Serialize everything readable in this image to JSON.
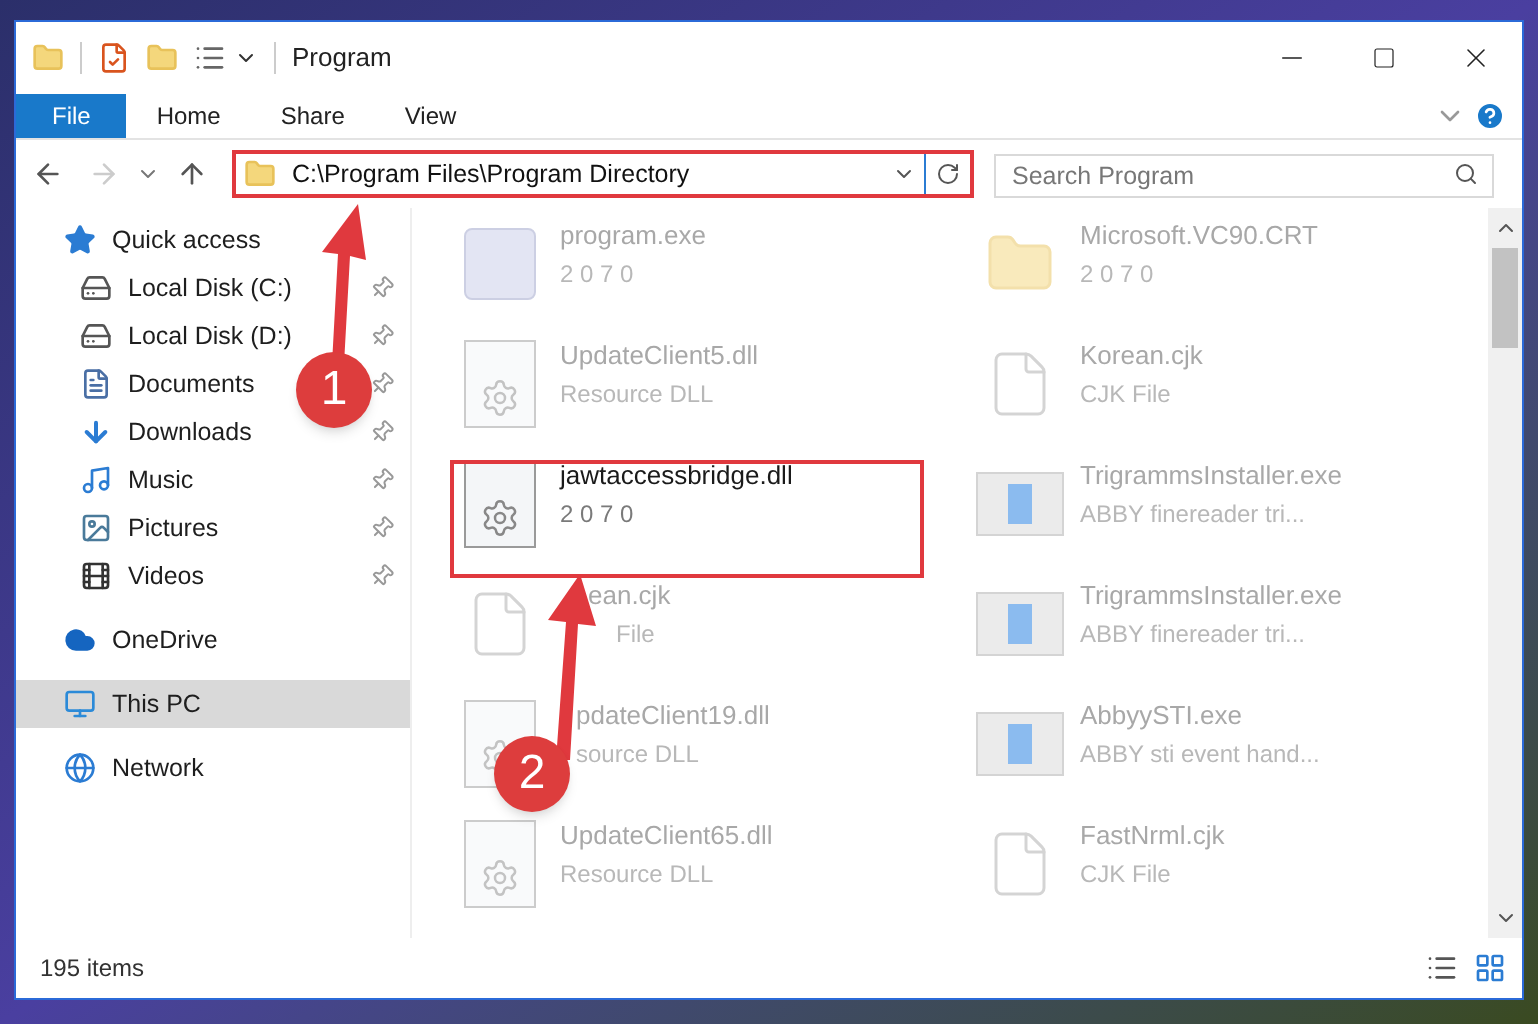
{
  "window": {
    "title": "Program"
  },
  "ribbon_tabs": [
    {
      "label": "File",
      "selected": true
    },
    {
      "label": "Home",
      "selected": false
    },
    {
      "label": "Share",
      "selected": false
    },
    {
      "label": "View",
      "selected": false
    }
  ],
  "address_bar": {
    "path": "C:\\Program Files\\Program Directory"
  },
  "search": {
    "placeholder": "Search Program"
  },
  "sidebar": {
    "items": [
      {
        "label": "Quick access",
        "kind": "star",
        "selected": false,
        "children": [
          {
            "label": "Local Disk (C:)",
            "kind": "system-drive",
            "pinned": true,
            "selected": false
          },
          {
            "label": "Local Disk (D:)",
            "kind": "drive",
            "pinned": true,
            "selected": false
          },
          {
            "label": "Documents",
            "kind": "documents",
            "pinned": true,
            "selected": false
          },
          {
            "label": "Downloads",
            "kind": "downloads",
            "pinned": true,
            "selected": false
          },
          {
            "label": "Music",
            "kind": "music",
            "pinned": true,
            "selected": false
          },
          {
            "label": "Pictures",
            "kind": "pictures",
            "pinned": true,
            "selected": false
          },
          {
            "label": "Videos",
            "kind": "videos",
            "pinned": true,
            "selected": false
          }
        ]
      },
      {
        "label": "OneDrive",
        "kind": "cloud",
        "selected": false
      },
      {
        "label": "This PC",
        "kind": "pc",
        "selected": true
      },
      {
        "label": "Network",
        "kind": "network",
        "selected": false
      }
    ]
  },
  "files": [
    {
      "name": "program.exe",
      "detail": "2 0 7 0",
      "kind": "app",
      "faded": true
    },
    {
      "name": "Microsoft.VC90.CRT",
      "detail": "2 0 7 0",
      "kind": "folder",
      "faded": true
    },
    {
      "name": "UpdateClient5.dll",
      "detail": "Resource DLL",
      "kind": "dll",
      "faded": true
    },
    {
      "name": "Korean.cjk",
      "detail": "CJK File",
      "kind": "blank",
      "faded": true
    },
    {
      "name": "jawtaccessbridge.dll",
      "detail": "2 0 7 0",
      "kind": "dll",
      "faded": false
    },
    {
      "name": "TrigrammsInstaller.exe",
      "detail": "ABBY finereader tri...",
      "kind": "installer",
      "faded": true
    },
    {
      "name": "ean.cjk",
      "detail": "File",
      "kind": "blank",
      "faded": true
    },
    {
      "name": "TrigrammsInstaller.exe",
      "detail": "ABBY finereader tri...",
      "kind": "installer",
      "faded": true
    },
    {
      "name": "pdateClient19.dll",
      "detail": "source DLL",
      "kind": "dll",
      "faded": true
    },
    {
      "name": "AbbyySTI.exe",
      "detail": "ABBY sti event hand...",
      "kind": "installer",
      "faded": true
    },
    {
      "name": "UpdateClient65.dll",
      "detail": "Resource DLL",
      "kind": "dll",
      "faded": true
    },
    {
      "name": "FastNrml.cjk",
      "detail": "CJK File",
      "kind": "blank",
      "faded": true
    }
  ],
  "status_bar": {
    "count": "195 items"
  },
  "annotations": [
    {
      "number": "1"
    },
    {
      "number": "2"
    }
  ]
}
